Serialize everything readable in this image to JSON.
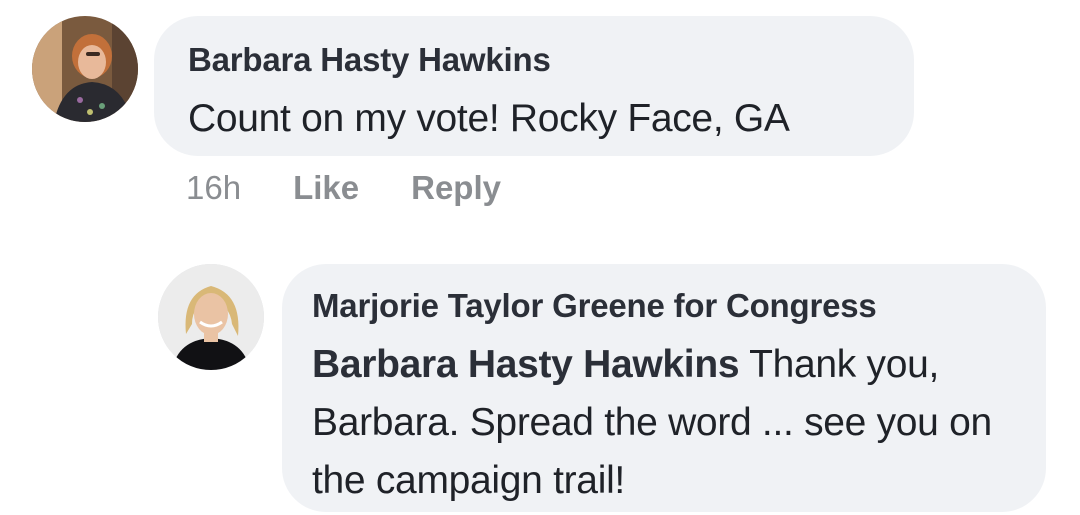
{
  "comment": {
    "author": "Barbara Hasty Hawkins",
    "text": "Count on my vote! Rocky Face, GA",
    "actions": {
      "timestamp": "16h",
      "like_label": "Like",
      "reply_label": "Reply"
    }
  },
  "reply": {
    "author": "Marjorie Taylor Greene for Congress",
    "mention": "Barbara Hasty Hawkins",
    "text": " Thank you, Barbara. Spread the word ... see you on the campaign trail!"
  }
}
